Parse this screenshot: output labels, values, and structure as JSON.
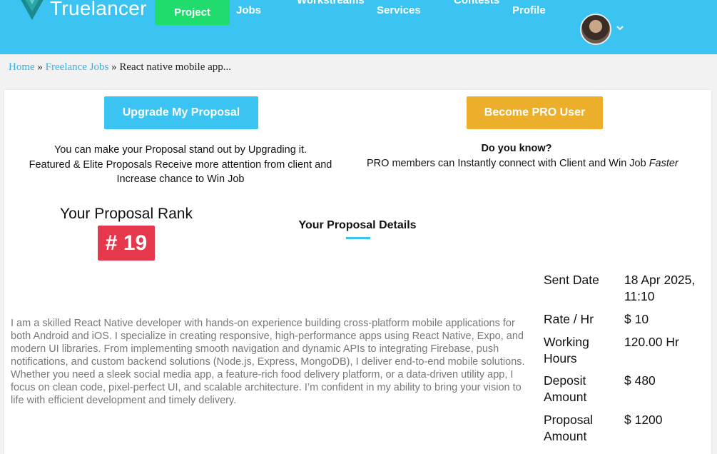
{
  "header": {
    "brand": "Truelancer",
    "nav": {
      "project": "Project",
      "jobs": "Jobs",
      "workstreams": "Workstreams",
      "services": "Services",
      "contests": "Contests",
      "profile": "Profile"
    },
    "colors": {
      "background": "#3bc3f1",
      "active_nav": "#1fdc6d"
    },
    "icons": {
      "logo": "truelancer-logo-icon",
      "chevron": "chevron-down-icon"
    }
  },
  "breadcrumb": {
    "home": "Home",
    "separator": "»",
    "freelance_jobs": "Freelance Jobs",
    "current": "React native mobile app..."
  },
  "upgrade": {
    "button_label": "Upgrade My Proposal",
    "line1": "You can make your Proposal stand out by Upgrading it.",
    "line2": "Featured & Elite Proposals Receive more attention from client and Increase chance to Win Job"
  },
  "pro": {
    "button_label": "Become PRO User",
    "title": "Do you know?",
    "text": "PRO members can Instantly connect with Client and Win Job",
    "emphasis": "Faster"
  },
  "rank": {
    "label": "Your Proposal Rank",
    "value": "# 19"
  },
  "details": {
    "title": "Your Proposal Details",
    "description": "I am a skilled React Native developer with hands-on experience building cross-platform mobile applications for both Android and iOS. I specialize in creating responsive, high-performance apps using React Native, Expo, and modern UI libraries. From implementing smooth navigation and dynamic APIs to integrating Firebase, push notifications, and custom backend solutions (Node.js, Express, MongoDB), I deliver end-to-end mobile solutions. Whether you need a sleek social media app, a feature-rich food delivery platform, or a data-driven utility app, I focus on clean code, pixel-perfect UI, and scalable architecture. I’m confident in my ability to bring your vision to life with efficient development and timely delivery.",
    "fields": {
      "sent_date_label": "Sent Date",
      "sent_date_value": "18 Apr 2025, 11:10",
      "rate_label": "Rate / Hr",
      "rate_value": "$ 10",
      "working_hours_label": "Working Hours",
      "working_hours_value": "120.00 Hr",
      "deposit_label": "Deposit Amount",
      "deposit_value": "$ 480",
      "proposal_amount_label": "Proposal Amount",
      "proposal_amount_value": "$ 1200"
    }
  }
}
